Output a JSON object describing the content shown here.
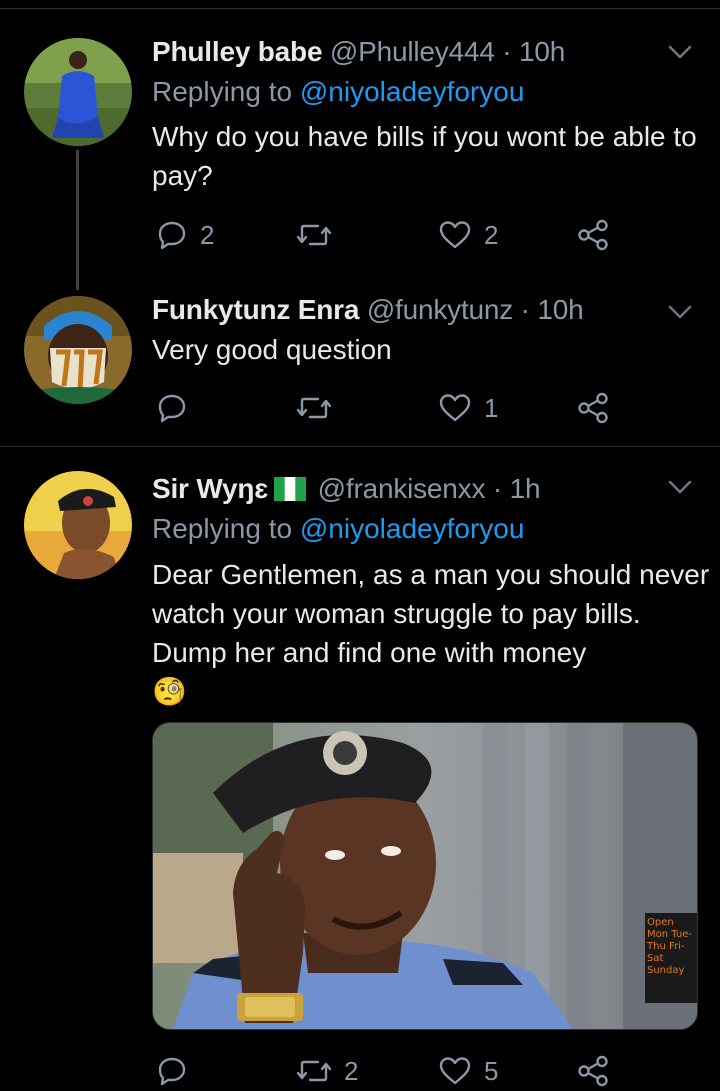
{
  "tweets": [
    {
      "name": "Phulley babe",
      "handle": "@Phulley444",
      "time": "10h",
      "replying_prefix": "Replying to",
      "replying_to": "@niyoladeyforyou",
      "text": "Why do you have bills if you wont be able to pay?",
      "replies": "2",
      "retweets": "",
      "likes": "2"
    },
    {
      "name": "Funkytunz Enra",
      "handle": "@funkytunz",
      "time": "10h",
      "text": "Very good question",
      "replies": "",
      "retweets": "",
      "likes": "1"
    },
    {
      "name": "Sir Wyŋɛ",
      "handle": "@frankisenxx",
      "time": "1h",
      "replying_prefix": "Replying to",
      "replying_to": "@niyoladeyforyou",
      "text": "Dear Gentlemen, as a man you should never watch your woman struggle to pay bills. Dump her and find one with money",
      "emoji": "🧐",
      "image_sign": "Open Mon Tue-Thu Fri-Sat Sunday",
      "replies": "",
      "retweets": "2",
      "likes": "5"
    }
  ],
  "separator": " · ",
  "colors": {
    "background": "#000000",
    "link": "#1d9bf0",
    "secondary_text": "#8b98a5"
  }
}
